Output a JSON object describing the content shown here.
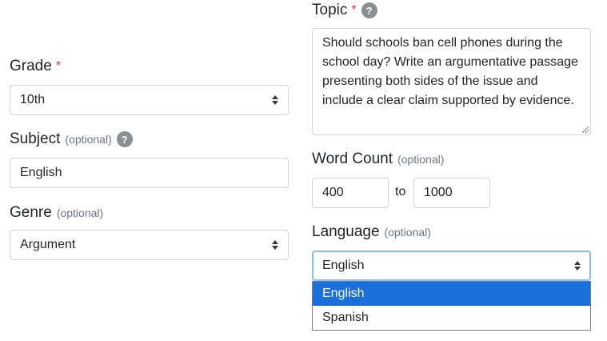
{
  "topic": {
    "label": "Topic",
    "required_mark": "*",
    "help_icon": "question-icon",
    "value": "Should schools ban cell phones during the school day? Write an argumentative passage presenting both sides of the issue and include a clear claim supported by evidence."
  },
  "grade": {
    "label": "Grade",
    "required_mark": "*",
    "value": "10th"
  },
  "subject": {
    "label": "Subject",
    "optional": "(optional)",
    "help_icon": "question-icon",
    "value": "English"
  },
  "genre": {
    "label": "Genre",
    "optional": "(optional)",
    "value": "Argument"
  },
  "word_count": {
    "label": "Word Count",
    "optional": "(optional)",
    "min": "400",
    "separator": "to",
    "max": "1000"
  },
  "language": {
    "label": "Language",
    "optional": "(optional)",
    "value": "English",
    "options": [
      "English",
      "Spanish"
    ],
    "selected_option": "English"
  },
  "colors": {
    "required": "#dc3545",
    "highlight": "#1a6fdb",
    "focus_border": "#80bdff"
  }
}
